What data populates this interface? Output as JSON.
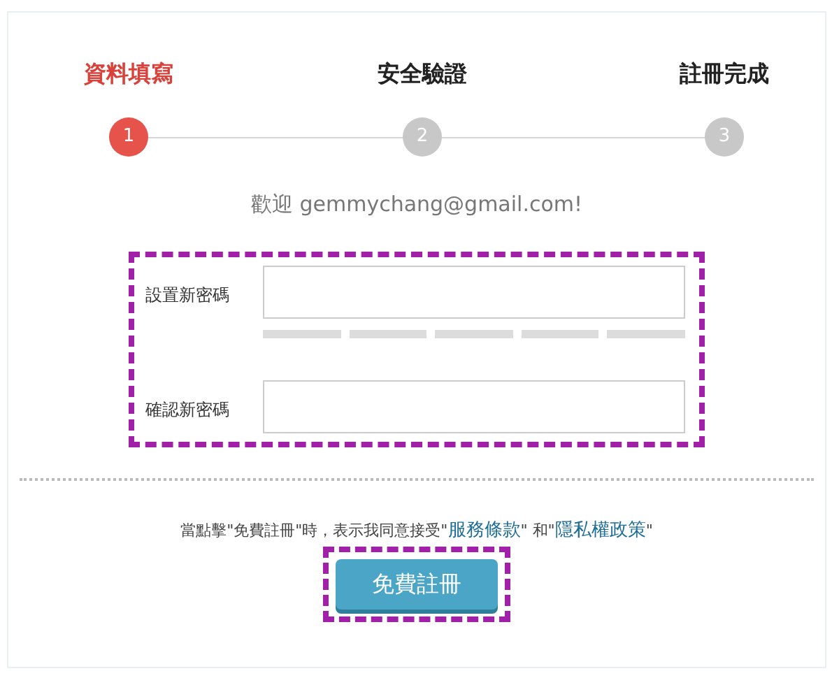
{
  "steps": [
    {
      "label": "資料填寫",
      "number": "1",
      "selected": true
    },
    {
      "label": "安全驗證",
      "number": "2",
      "selected": false
    },
    {
      "label": "註冊完成",
      "number": "3",
      "selected": false
    }
  ],
  "welcome": "歡迎 gemmychang@gmail.com!",
  "fields": [
    {
      "label": "設置新密碼",
      "kind": "password-with-meter"
    },
    {
      "label": "確認新密碼",
      "kind": "password"
    }
  ],
  "terms": {
    "before": "當點擊\"免費註冊\"時，表示我同意接受\"",
    "link_1": "服務條款",
    "middle": "\" 和\"",
    "link_2": "隱私權政策",
    "after": "\""
  },
  "submit_button": "免費註冊"
}
